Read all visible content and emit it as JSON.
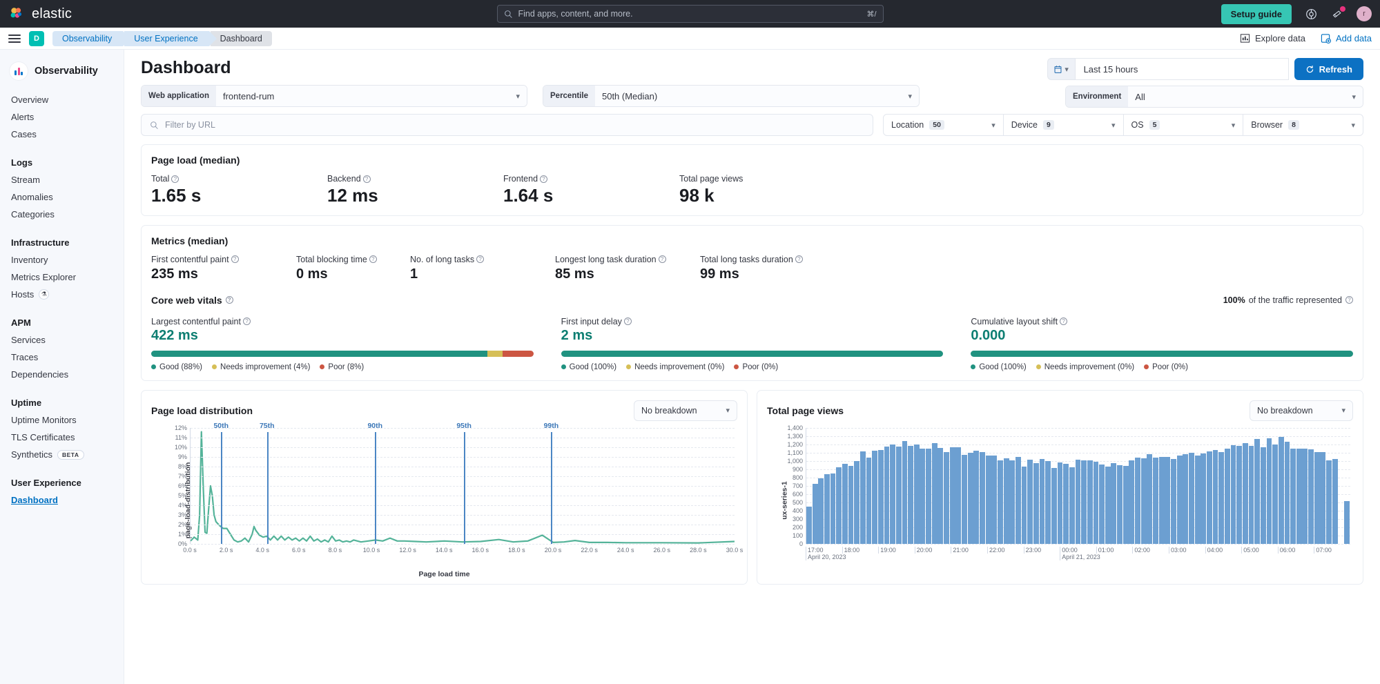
{
  "topnav": {
    "brand": "elastic",
    "search_placeholder": "Find apps, content, and more.",
    "search_kbd": "⌘/",
    "setup_guide": "Setup guide",
    "help_icon": "help-icon",
    "announcements_icon": "announcements-icon",
    "avatar_initial": "r"
  },
  "breadcrumb": {
    "space_initial": "D",
    "items": [
      {
        "label": "Observability"
      },
      {
        "label": "User Experience"
      },
      {
        "label": "Dashboard"
      }
    ],
    "explore_data": "Explore data",
    "add_data": "Add data"
  },
  "sidebar": {
    "title": "Observability",
    "groups": [
      {
        "heading": "",
        "items": [
          {
            "label": "Overview"
          },
          {
            "label": "Alerts"
          },
          {
            "label": "Cases"
          }
        ]
      },
      {
        "heading": "Logs",
        "items": [
          {
            "label": "Stream"
          },
          {
            "label": "Anomalies"
          },
          {
            "label": "Categories"
          }
        ]
      },
      {
        "heading": "Infrastructure",
        "items": [
          {
            "label": "Inventory"
          },
          {
            "label": "Metrics Explorer"
          },
          {
            "label": "Hosts",
            "badge": "flask"
          }
        ]
      },
      {
        "heading": "APM",
        "items": [
          {
            "label": "Services"
          },
          {
            "label": "Traces"
          },
          {
            "label": "Dependencies"
          }
        ]
      },
      {
        "heading": "Uptime",
        "items": [
          {
            "label": "Uptime Monitors"
          },
          {
            "label": "TLS Certificates"
          },
          {
            "label": "Synthetics",
            "badge": "BETA"
          }
        ]
      },
      {
        "heading": "User Experience",
        "items": [
          {
            "label": "Dashboard",
            "active": true
          }
        ]
      }
    ]
  },
  "page": {
    "title": "Dashboard",
    "filters": {
      "web_application_label": "Web application",
      "web_application_value": "frontend-rum",
      "percentile_label": "Percentile",
      "percentile_value": "50th (Median)",
      "environment_label": "Environment",
      "environment_value": "All"
    },
    "time": {
      "range": "Last 15 hours",
      "refresh_label": "Refresh",
      "calendar_icon": "calendar-icon"
    },
    "url_filter_placeholder": "Filter by URL",
    "facets": [
      {
        "name": "Location",
        "count": "50"
      },
      {
        "name": "Device",
        "count": "9"
      },
      {
        "name": "OS",
        "count": "5"
      },
      {
        "name": "Browser",
        "count": "8"
      }
    ]
  },
  "page_load": {
    "title": "Page load (median)",
    "metrics": [
      {
        "label": "Total",
        "value": "1.65 s",
        "has_tooltip": true
      },
      {
        "label": "Backend",
        "value": "12 ms",
        "has_tooltip": true
      },
      {
        "label": "Frontend",
        "value": "1.64 s",
        "has_tooltip": true
      },
      {
        "label": "Total page views",
        "value": "98 k",
        "has_tooltip": false
      }
    ]
  },
  "metrics": {
    "title": "Metrics (median)",
    "items": [
      {
        "label": "First contentful paint",
        "value": "235 ms",
        "has_tooltip": true
      },
      {
        "label": "Total blocking time",
        "value": "0 ms",
        "has_tooltip": true
      },
      {
        "label": "No. of long tasks",
        "value": "1",
        "has_tooltip": true
      },
      {
        "label": "Longest long task duration",
        "value": "85 ms",
        "has_tooltip": true
      },
      {
        "label": "Total long tasks duration",
        "value": "99 ms",
        "has_tooltip": true
      }
    ]
  },
  "core_web_vitals": {
    "title": "Core web vitals",
    "traffic_pct": "100%",
    "traffic_text": "of the traffic represented",
    "colors": {
      "good": "#209280",
      "needs": "#d6bf57",
      "poor": "#cc5642"
    },
    "items": [
      {
        "label": "Largest contentful paint",
        "value": "422 ms",
        "good_pct": 88,
        "needs_pct": 4,
        "poor_pct": 8,
        "legend": [
          "Good (88%)",
          "Needs improvement (4%)",
          "Poor (8%)"
        ]
      },
      {
        "label": "First input delay",
        "value": "2 ms",
        "good_pct": 100,
        "needs_pct": 0,
        "poor_pct": 0,
        "legend": [
          "Good (100%)",
          "Needs improvement (0%)",
          "Poor (0%)"
        ]
      },
      {
        "label": "Cumulative layout shift",
        "value": "0.000",
        "good_pct": 100,
        "needs_pct": 0,
        "poor_pct": 0,
        "legend": [
          "Good (100%)",
          "Needs improvement (0%)",
          "Poor (0%)"
        ]
      }
    ]
  },
  "page_load_distribution": {
    "title": "Page load distribution",
    "breakdown": "No breakdown"
  },
  "total_page_views": {
    "title": "Total page views",
    "breakdown": "No breakdown"
  },
  "chart_data": [
    {
      "type": "line",
      "title": "Page load distribution",
      "xlabel": "Page load time",
      "ylabel": "page-load-distribution",
      "xlim": [
        0,
        30
      ],
      "ylim": [
        0,
        12
      ],
      "grid": true,
      "legend": "none",
      "color": "#54b399",
      "x_ticks": [
        "0.0 s",
        "2.0 s",
        "4.0 s",
        "6.0 s",
        "8.0 s",
        "10.0 s",
        "12.0 s",
        "14.0 s",
        "16.0 s",
        "18.0 s",
        "20.0 s",
        "22.0 s",
        "24.0 s",
        "26.0 s",
        "28.0 s",
        "30.0 s"
      ],
      "y_ticks": [
        "0%",
        "1%",
        "2%",
        "3%",
        "4%",
        "5%",
        "6%",
        "7%",
        "8%",
        "9%",
        "10%",
        "11%",
        "12%"
      ],
      "annotations": [
        {
          "label": "50th",
          "x": 1.72
        },
        {
          "label": "75th",
          "x": 4.25
        },
        {
          "label": "90th",
          "x": 10.2
        },
        {
          "label": "95th",
          "x": 15.1
        },
        {
          "label": "99th",
          "x": 19.9
        }
      ],
      "x": [
        0.0,
        0.2,
        0.4,
        0.5,
        0.6,
        0.7,
        0.8,
        0.9,
        1.0,
        1.1,
        1.2,
        1.3,
        1.4,
        1.5,
        1.6,
        1.8,
        2.0,
        2.2,
        2.4,
        2.6,
        2.8,
        3.0,
        3.2,
        3.4,
        3.5,
        3.6,
        3.8,
        4.0,
        4.2,
        4.4,
        4.6,
        4.8,
        5.0,
        5.2,
        5.4,
        5.6,
        5.8,
        6.0,
        6.2,
        6.4,
        6.6,
        6.8,
        7.0,
        7.2,
        7.4,
        7.6,
        7.8,
        8.0,
        8.2,
        8.4,
        8.6,
        8.8,
        9.0,
        9.4,
        9.8,
        10.2,
        10.6,
        11.0,
        11.4,
        11.8,
        12.4,
        13.0,
        14.0,
        15.0,
        16.0,
        17.0,
        17.8,
        18.6,
        19.4,
        20.0,
        20.6,
        21.2,
        22.0,
        23.0,
        24.0,
        26.0,
        28.0,
        30.0
      ],
      "y": [
        0.3,
        0.7,
        0.4,
        3.0,
        11.6,
        6.0,
        1.2,
        1.1,
        3.6,
        6.0,
        5.0,
        3.0,
        2.3,
        2.1,
        1.9,
        1.6,
        1.6,
        1.0,
        0.4,
        0.2,
        0.3,
        0.6,
        0.2,
        1.0,
        1.8,
        1.4,
        0.9,
        0.7,
        0.8,
        0.4,
        0.8,
        0.4,
        0.8,
        0.4,
        0.7,
        0.4,
        0.6,
        0.3,
        0.6,
        0.3,
        0.8,
        0.3,
        0.5,
        0.2,
        0.4,
        0.2,
        0.8,
        0.3,
        0.4,
        0.2,
        0.3,
        0.2,
        0.4,
        0.2,
        0.3,
        0.4,
        0.3,
        0.6,
        0.3,
        0.3,
        0.25,
        0.2,
        0.3,
        0.2,
        0.25,
        0.45,
        0.2,
        0.3,
        0.9,
        0.15,
        0.2,
        0.35,
        0.15,
        0.15,
        0.12,
        0.12,
        0.1,
        0.25
      ]
    },
    {
      "type": "bar",
      "title": "Total page views",
      "xlabel": "",
      "ylabel": "ux-series-1",
      "ylim": [
        0,
        1400
      ],
      "grid": true,
      "legend": "none",
      "color": "#6c9fd1",
      "y_ticks": [
        "0",
        "100",
        "200",
        "300",
        "400",
        "500",
        "600",
        "700",
        "800",
        "900",
        "1,000",
        "1,100",
        "1,200",
        "1,300",
        "1,400"
      ],
      "x_ticks": [
        {
          "label": "17:00",
          "sub": "April 20, 2023"
        },
        {
          "label": "18:00",
          "sub": ""
        },
        {
          "label": "19:00",
          "sub": ""
        },
        {
          "label": "20:00",
          "sub": ""
        },
        {
          "label": "21:00",
          "sub": ""
        },
        {
          "label": "22:00",
          "sub": ""
        },
        {
          "label": "23:00",
          "sub": ""
        },
        {
          "label": "00:00",
          "sub": "April 21, 2023"
        },
        {
          "label": "01:00",
          "sub": ""
        },
        {
          "label": "02:00",
          "sub": ""
        },
        {
          "label": "03:00",
          "sub": ""
        },
        {
          "label": "04:00",
          "sub": ""
        },
        {
          "label": "05:00",
          "sub": ""
        },
        {
          "label": "06:00",
          "sub": ""
        },
        {
          "label": "07:00",
          "sub": ""
        }
      ],
      "values": [
        450,
        727,
        793,
        842,
        846,
        925,
        965,
        940,
        997,
        1117,
        1043,
        1128,
        1136,
        1177,
        1198,
        1178,
        1241,
        1185,
        1196,
        1146,
        1148,
        1214,
        1160,
        1104,
        1168,
        1164,
        1071,
        1100,
        1128,
        1104,
        1063,
        1070,
        1005,
        1031,
        1011,
        1053,
        934,
        1019,
        974,
        1022,
        1000,
        913,
        985,
        970,
        923,
        1012,
        1005,
        1008,
        989,
        958,
        935,
        978,
        950,
        938,
        1011,
        1038,
        1033,
        1080,
        1040,
        1046,
        1052,
        1025,
        1064,
        1085,
        1097,
        1063,
        1091,
        1115,
        1129,
        1110,
        1148,
        1192,
        1179,
        1213,
        1185,
        1262,
        1169,
        1273,
        1198,
        1289,
        1230,
        1150,
        1147,
        1152,
        1145,
        1110,
        1110,
        1005,
        1023,
        0,
        520
      ]
    }
  ]
}
